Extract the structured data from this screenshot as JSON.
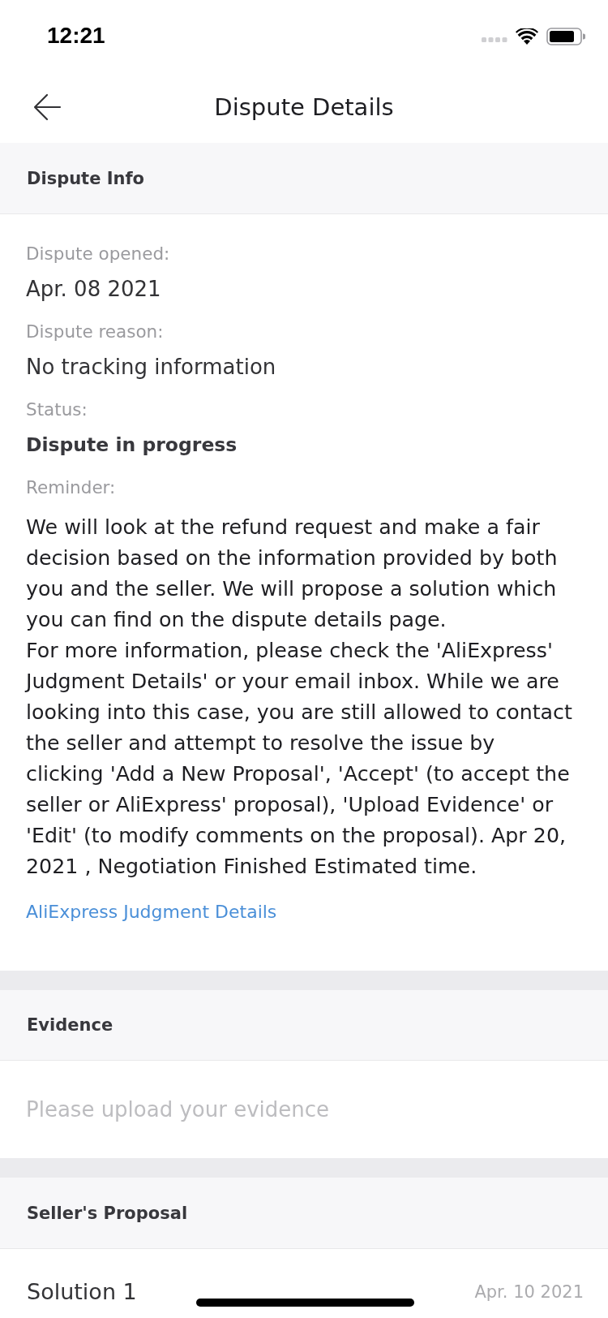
{
  "status_bar": {
    "time": "12:21"
  },
  "nav_bar": {
    "title": "Dispute Details"
  },
  "dispute_info": {
    "title": "Dispute Info",
    "fields": [
      {
        "kind": "plain",
        "label": "Dispute opened:",
        "value": "Apr. 08 2021"
      },
      {
        "kind": "plain",
        "label": "Dispute reason:",
        "value": "No tracking information"
      },
      {
        "kind": "emphasis",
        "label": "Status:",
        "value": "Dispute in progress"
      }
    ],
    "reminder": {
      "label": "Reminder:",
      "paragraphs": [
        "We will look at the refund request and make a fair decision based on the information provided by both you and the seller. We will propose a solution which you can find on the dispute details page.",
        "For more information, please check the 'AliExpress' Judgment Details' or your email inbox. While we are looking into this case, you are still allowed to contact the seller and attempt to resolve the issue by clicking 'Add a New Proposal', 'Accept' (to accept the seller or AliExpress' proposal), 'Upload Evidence' or 'Edit' (to modify comments on the proposal). Apr 20, 2021 , Negotiation Finished Estimated time."
      ]
    },
    "link": "AliExpress Judgment Details"
  },
  "evidence": {
    "title": "Evidence",
    "message": "Please upload your evidence"
  },
  "sellers_proposal": {
    "title": "Seller's Proposal",
    "solutions": [
      {
        "name": "Solution 1",
        "date": "Apr. 10 2021"
      }
    ]
  }
}
